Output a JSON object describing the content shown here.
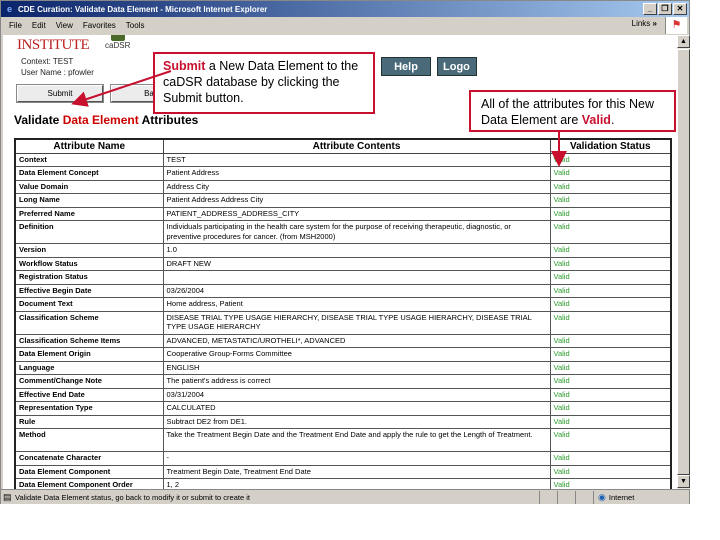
{
  "window": {
    "title": "CDE Curation: Validate Data Element - Microsoft Internet Explorer",
    "controls": [
      "_",
      "❐",
      "✕"
    ]
  },
  "menu": [
    "File",
    "Edit",
    "View",
    "Favorites",
    "Tools"
  ],
  "links_label": "Links",
  "links_chevron": "»",
  "header": {
    "logo_text": "INSTITUTE",
    "cadsr_text": "caDSR",
    "context": "Context: TEST",
    "user": "User Name : pfowler",
    "help_label": "Help",
    "logout_label": "Logo"
  },
  "buttons": {
    "submit": "Submit",
    "back": "Back"
  },
  "heading": {
    "part1": "Validate ",
    "accent": "Data Element",
    "part2": " Attributes"
  },
  "table": {
    "headers": [
      "Attribute Name",
      "Attribute Contents",
      "Validation Status"
    ],
    "rows": [
      {
        "name": "Context",
        "content": "TEST",
        "status": "Valid"
      },
      {
        "name": "Data Element Concept",
        "content": "Patient Address",
        "status": "Valid"
      },
      {
        "name": "Value Domain",
        "content": "Address City",
        "status": "Valid"
      },
      {
        "name": "Long Name",
        "content": "Patient Address Address City",
        "status": "Valid"
      },
      {
        "name": "Preferred Name",
        "content": "PATIENT_ADDRESS_ADDRESS_CITY",
        "status": "Valid"
      },
      {
        "name": "Definition",
        "content": "Individuals participating in the health care system for the purpose of receiving therapeutic, diagnostic, or preventive procedures for cancer. (from MSH2000)",
        "status": "Valid"
      },
      {
        "name": "Version",
        "content": "1.0",
        "status": "Valid"
      },
      {
        "name": "Workflow Status",
        "content": "DRAFT NEW",
        "status": "Valid"
      },
      {
        "name": "Registration Status",
        "content": "",
        "status": "Valid"
      },
      {
        "name": "Effective Begin Date",
        "content": "03/26/2004",
        "status": "Valid"
      },
      {
        "name": "Document Text",
        "content": "Home address, Patient",
        "status": "Valid"
      },
      {
        "name": "Classification Scheme",
        "content": "DISEASE TRIAL TYPE USAGE HIERARCHY, DISEASE TRIAL TYPE USAGE HIERARCHY, DISEASE TRIAL TYPE USAGE HIERARCHY",
        "status": "Valid"
      },
      {
        "name": "Classification Scheme Items",
        "content": "ADVANCED, METASTATIC/UROTHELI*, ADVANCED",
        "status": "Valid"
      },
      {
        "name": "Data Element Origin",
        "content": "Cooperative Group-Forms Committee",
        "status": "Valid"
      },
      {
        "name": "Language",
        "content": "ENGLISH",
        "status": "Valid"
      },
      {
        "name": "Comment/Change Note",
        "content": "The patient's address is correct",
        "status": "Valid"
      },
      {
        "name": "Effective End Date",
        "content": "03/31/2004",
        "status": "Valid"
      },
      {
        "name": "Representation Type",
        "content": "CALCULATED",
        "status": "Valid"
      },
      {
        "name": "Rule",
        "content": "Subtract DE2 from DE1.",
        "status": "Valid"
      },
      {
        "name": "Method",
        "content": "Take the Treatment Begin Date and the Treatment End Date and apply the rule to get the Length of Treatment.",
        "status": "Valid"
      },
      {
        "name": "Concatenate Character",
        "content": "-",
        "status": "Valid"
      },
      {
        "name": "Data Element Component",
        "content": "Treatment Begin Date, Treatment End Date",
        "status": "Valid"
      },
      {
        "name": "Data Element Component Order",
        "content": "1, 2",
        "status": "Valid"
      }
    ]
  },
  "callouts": {
    "submit": {
      "accent": "Submit",
      "text": " a New Data Element to the caDSR database by clicking the Submit button."
    },
    "valid": {
      "text": "All of the attributes for this New Data Element are ",
      "accent": "Valid",
      "end": "."
    }
  },
  "status_bar": {
    "text": "Validate Data Element status, go back to modify it or submit to create it",
    "zone": "Internet"
  },
  "colors": {
    "accent_red": "#c8102e",
    "valid_green": "#2a9a2a",
    "title_blue": "#0a246a"
  }
}
